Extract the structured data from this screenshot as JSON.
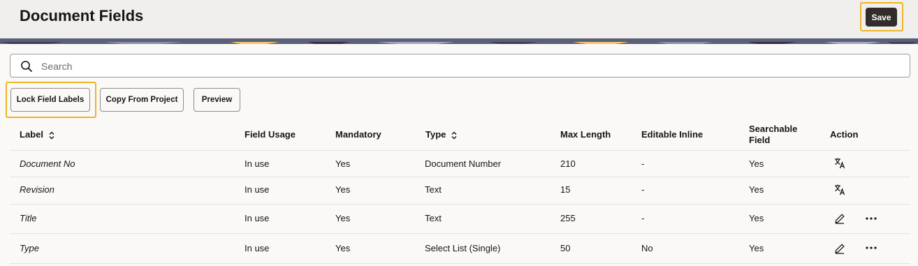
{
  "header": {
    "title": "Document Fields",
    "save_label": "Save"
  },
  "search": {
    "placeholder": "Search",
    "value": ""
  },
  "toolbar": {
    "lock_label": "Lock Field Labels",
    "copy_label": "Copy From Project",
    "preview_label": "Preview"
  },
  "table": {
    "columns": {
      "label": "Label",
      "usage": "Field Usage",
      "mandatory": "Mandatory",
      "type": "Type",
      "maxlength": "Max Length",
      "editable": "Editable Inline",
      "searchable_1": "Searchable",
      "searchable_2": "Field",
      "action": "Action"
    },
    "rows": [
      {
        "label": "Document No",
        "usage": "In use",
        "mandatory": "Yes",
        "type": "Document Number",
        "maxlength": "210",
        "editable": "-",
        "searchable": "Yes",
        "actions": [
          "translate-icon"
        ]
      },
      {
        "label": "Revision",
        "usage": "In use",
        "mandatory": "Yes",
        "type": "Text",
        "maxlength": "15",
        "editable": "-",
        "searchable": "Yes",
        "actions": [
          "translate-icon"
        ]
      },
      {
        "label": "Title",
        "usage": "In use",
        "mandatory": "Yes",
        "type": "Text",
        "maxlength": "255",
        "editable": "-",
        "searchable": "Yes",
        "actions": [
          "edit-icon",
          "more-icon"
        ]
      },
      {
        "label": "Type",
        "usage": "In use",
        "mandatory": "Yes",
        "type": "Select List (Single)",
        "maxlength": "50",
        "editable": "No",
        "searchable": "Yes",
        "actions": [
          "edit-icon",
          "more-icon"
        ]
      }
    ]
  },
  "colors": {
    "highlight": "#f0b323",
    "primary_button": "#312d2a",
    "banner": "#5b5f78"
  }
}
